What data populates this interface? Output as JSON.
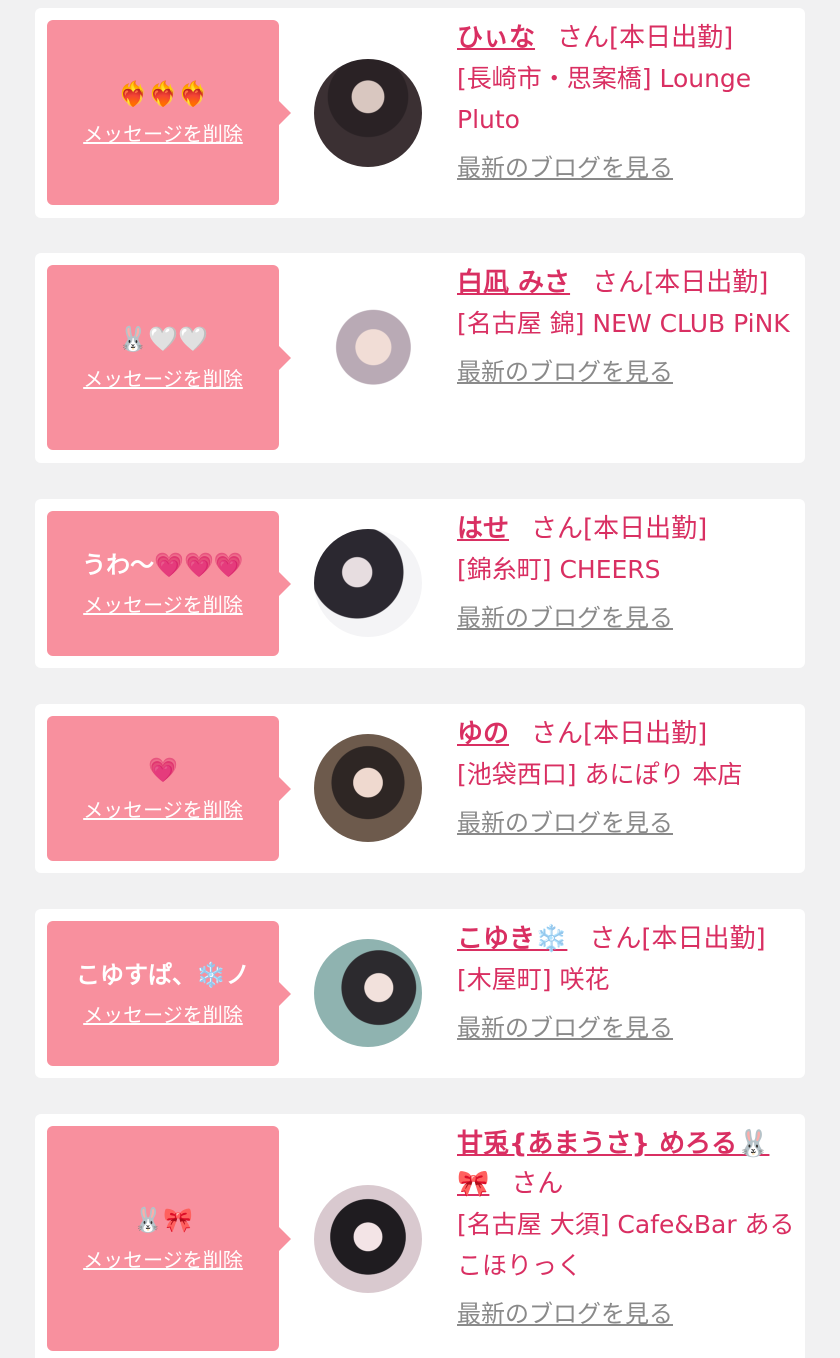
{
  "common": {
    "delete_label": "メッセージを削除",
    "blog_label": "最新のブログを見る",
    "san": "さん",
    "status": "[本日出勤]"
  },
  "cards": [
    {
      "message": "❤️‍🔥❤️‍🔥❤️‍🔥",
      "name": "ひぃな",
      "shop": "[長崎市・思案橋] Lounge Pluto"
    },
    {
      "message": "🐰🤍🤍",
      "name": "白凪 みさ",
      "shop": "[名古屋 錦] NEW CLUB PiNK"
    },
    {
      "message": "うわ〜💗💗💗",
      "name": "はせ",
      "shop": "[錦糸町] CHEERS"
    },
    {
      "message": "💗",
      "name": "ゆの",
      "shop": "[池袋西口] あにぽり 本店"
    },
    {
      "message": "こゆすぱ、❄️ノ",
      "name": "こゆき❄️",
      "shop": "[木屋町] 咲花"
    },
    {
      "message": "🐰🎀",
      "name": "甘兎{あまうさ} めろる🐰🎀",
      "shop": "[名古屋 大須] Cafe&Bar あるこほりっく"
    }
  ]
}
